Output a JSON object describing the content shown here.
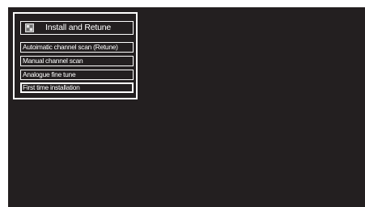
{
  "menu": {
    "title": "Install and Retune",
    "header_icon": "install-settings-icon",
    "items": [
      {
        "label": "Autoimatic channel scan (Retune)",
        "selected": false
      },
      {
        "label": "Manual channel scan",
        "selected": false
      },
      {
        "label": "Analogue fine tune",
        "selected": false
      },
      {
        "label": "First time installation",
        "selected": true
      }
    ]
  },
  "colors": {
    "screen_background": "#231f20",
    "border": "#ffffff",
    "text": "#ffffff",
    "icon": "#9b9b9b"
  }
}
